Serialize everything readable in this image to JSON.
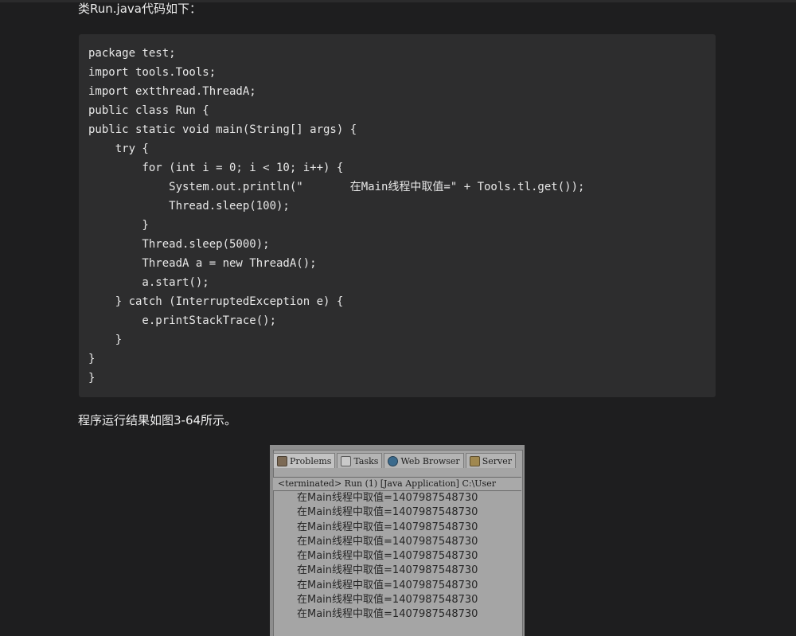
{
  "article": {
    "intro_text": "类Run.java代码如下：",
    "result_text": "程序运行结果如图3-64所示。"
  },
  "code": {
    "lines": [
      "package test;",
      "import tools.Tools;",
      "import extthread.ThreadA;",
      "public class Run {",
      "public static void main(String[] args) {",
      "    try {",
      "        for (int i = 0; i < 10; i++) {",
      "            System.out.println(\"       在Main线程中取值=\" + Tools.tl.get());",
      "            Thread.sleep(100);",
      "        }",
      "        Thread.sleep(5000);",
      "        ThreadA a = new ThreadA();",
      "        a.start();",
      "    } catch (InterruptedException e) {",
      "        e.printStackTrace();",
      "    }",
      "}",
      "}"
    ]
  },
  "console": {
    "tabs": [
      {
        "label": "Problems",
        "icon": "problems-icon"
      },
      {
        "label": "Tasks",
        "icon": "tasks-icon"
      },
      {
        "label": "Web Browser",
        "icon": "web-browser-icon"
      },
      {
        "label": "Server",
        "icon": "servers-icon"
      }
    ],
    "status": "<terminated> Run (1) [Java Application] C:\\User",
    "output_lines": [
      "在Main线程中取值=1407987548730",
      "在Main线程中取值=1407987548730",
      "在Main线程中取值=1407987548730",
      "在Main线程中取值=1407987548730",
      "在Main线程中取值=1407987548730",
      "在Main线程中取值=1407987548730",
      "在Main线程中取值=1407987548730",
      "在Main线程中取值=1407987548730",
      "在Main线程中取值=1407987548730"
    ]
  }
}
